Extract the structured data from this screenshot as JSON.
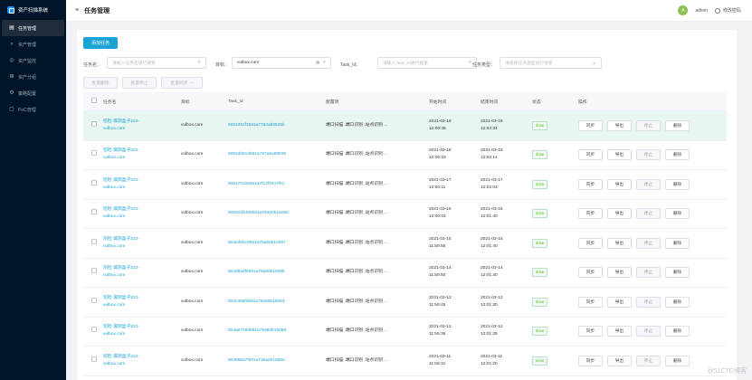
{
  "app": {
    "title": "资产扫描系统"
  },
  "sidebar": {
    "items": [
      {
        "label": "任务管理",
        "icon": "doc-icon",
        "active": true
      },
      {
        "label": "资产管理",
        "icon": "search-icon",
        "active": false
      },
      {
        "label": "资产监控",
        "icon": "monitor-icon",
        "active": false
      },
      {
        "label": "资产分组",
        "icon": "group-icon",
        "active": false
      },
      {
        "label": "策略配置",
        "icon": "settings-icon",
        "active": false
      },
      {
        "label": "PoC管理",
        "icon": "poc-icon",
        "active": false
      }
    ]
  },
  "header": {
    "menu_icon": "menu-icon",
    "title": "任务管理",
    "user": "admin",
    "avatar_letter": "A",
    "logout": "修改密码"
  },
  "toolbar": {
    "add_task": "添加任务"
  },
  "filters": {
    "task_name": {
      "label": "任务名：",
      "placeholder": "请输入任务名进行搜索"
    },
    "target": {
      "label": "目标：",
      "value": "vulbox.com"
    },
    "task_id": {
      "label": "Task_Id：",
      "placeholder": "请输入Task_Id进行搜索"
    },
    "task_type": {
      "label": "任务类型：",
      "placeholder": "请选择任务类型进行搜索"
    }
  },
  "batch": {
    "delete": "批量删除",
    "stop": "批量停止",
    "sync": "批量同步"
  },
  "table": {
    "headers": {
      "name": "任务名",
      "target": "目标",
      "task_id": "Task_Id",
      "config": "配置项",
      "start": "开始时间",
      "end": "结束时间",
      "state": "状态",
      "ops": "操作"
    },
    "ops": {
      "sync": "同步",
      "export": "导出",
      "stop": "停止",
      "delete": "删除"
    },
    "rows": [
      {
        "name1": "巡检-漏洞盒子222-",
        "name2": "vulbox.com",
        "target": "vulbox.com",
        "task_id": "6054215f1591a7760ab5625b",
        "config": "端口扫描 ,端口识别 ,站点识别 ...",
        "start_date": "2021-03-19",
        "start_time": "12:00:45",
        "end_date": "2021-03-19",
        "end_time": "12:02:34",
        "state": "done"
      },
      {
        "name1": "巡检-漏洞盒子222-",
        "name2": "vulbox.com",
        "target": "vulbox.com",
        "task_id": "6052d061d591a787a5a08039",
        "config": "端口扫描 ,端口识别 ,站点识别 ...",
        "start_date": "2021-03-18",
        "start_time": "12:00:33",
        "end_date": "2021-03-18",
        "end_time": "12:02:14",
        "state": "done"
      },
      {
        "name1": "巡检-漏洞盒子222-",
        "name2": "vulbox.com",
        "target": "vulbox.com",
        "task_id": "60517ecb6591a7f13f7547f01",
        "config": "端口扫描 ,端口识别 ,站点识别 ...",
        "start_date": "2021-03-17",
        "start_time": "12:00:11",
        "end_date": "2021-03-17",
        "end_time": "12:02:03",
        "state": "done"
      },
      {
        "name1": "巡检-漏洞盒子222-",
        "name2": "vulbox.com",
        "target": "vulbox.com",
        "task_id": "60502d4459591a75a60b1508d",
        "config": "端口扫描 ,端口识别 ,站点识别 ...",
        "start_date": "2021-03-16",
        "start_time": "12:00:04",
        "end_date": "2021-03-16",
        "end_time": "12:01:40",
        "state": "done"
      },
      {
        "name1": "巡检-漏洞盒子222-",
        "name2": "vulbox.com",
        "target": "vulbox.com",
        "task_id": "604edbbc9591a75a60b15087",
        "config": "端口扫描 ,端口识别 ,站点识别 ...",
        "start_date": "2021-03-15",
        "start_time": "11:59:56",
        "end_date": "2021-03-15",
        "end_time": "12:01:40",
        "state": "done"
      },
      {
        "name1": "巡检-漏洞盒子222-",
        "name2": "vulbox.com",
        "target": "vulbox.com",
        "task_id": "604d8a3f6591a75a60b1508b",
        "config": "端口扫描 ,端口识别 ,站点识别 ...",
        "start_date": "2021-03-14",
        "start_time": "11:59:50",
        "end_date": "2021-03-14",
        "end_time": "12:01:30",
        "state": "done"
      },
      {
        "name1": "巡检-漏洞盒子222-",
        "name2": "vulbox.com",
        "target": "vulbox.com",
        "task_id": "604c38afd591a75a60b15083",
        "config": "端口扫描 ,端口识别 ,站点识别 ...",
        "start_date": "2021-03-13",
        "start_time": "11:59:45",
        "end_date": "2021-03-13",
        "end_time": "12:01:30",
        "state": "done"
      },
      {
        "name1": "巡检-漏洞盒子222-",
        "name2": "vulbox.com",
        "target": "vulbox.com",
        "task_id": "604ae728d591a75a60b150B4",
        "config": "端口扫描 ,端口识别 ,站点识别 ...",
        "start_date": "2021-03-12",
        "start_time": "11:59:36",
        "end_date": "2021-03-12",
        "end_time": "12:01:25",
        "state": "done"
      },
      {
        "name1": "巡检-漏洞盒子222-",
        "name2": "vulbox.com",
        "target": "vulbox.com",
        "task_id": "604995a7f591a738aeb15b6d",
        "config": "端口扫描 ,端口识别 ,站点识别 ...",
        "start_date": "2021-03-11",
        "start_time": "11:59:31",
        "end_date": "2021-03-11",
        "end_time": "12:01:20",
        "state": "done"
      }
    ]
  },
  "watermark": "@51CTO博客",
  "colors": {
    "sidebar": "#001529",
    "accent": "#1aa3d4",
    "highlight_row": "#e8f6f1",
    "done": "#52c41a"
  }
}
